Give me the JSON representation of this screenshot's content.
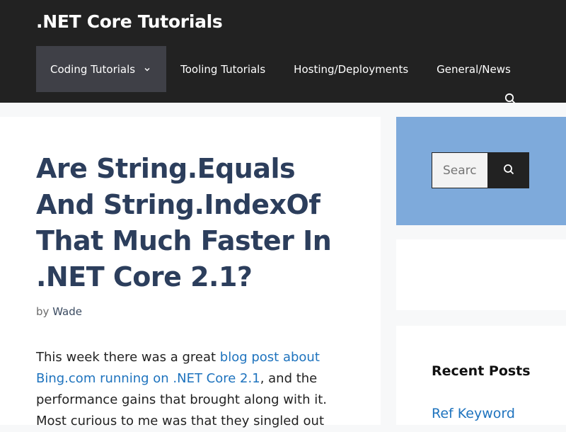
{
  "header": {
    "site_title": ".NET Core Tutorials",
    "background": "#222222"
  },
  "nav": {
    "items": [
      {
        "label": "Coding Tutorials",
        "has_dropdown": true,
        "active": true
      },
      {
        "label": "Tooling Tutorials"
      },
      {
        "label": "Hosting/Deployments"
      },
      {
        "label": "General/News"
      }
    ],
    "search_icon": "search-icon"
  },
  "post": {
    "title": "Are String.Equals And String.IndexOf That Much Faster In .NET Core 2.1?",
    "byline_prefix": "by",
    "author": "Wade",
    "body": {
      "intro": "This week there was a great ",
      "link_text": "blog post about Bing.com running on .NET Core 2.1",
      "after_link": ", and the performance gains that brought along with it. Most curious to me was that they singled out"
    }
  },
  "sidebar": {
    "search": {
      "placeholder": "Search",
      "button_icon": "search-icon",
      "background": "#7eaadb"
    },
    "recent_posts": {
      "title": "Recent Posts",
      "items": [
        "Ref Keyword"
      ]
    }
  },
  "colors": {
    "title": "#2c3e5c",
    "link": "#1e73be",
    "page_bg": "#f7f8f9"
  }
}
